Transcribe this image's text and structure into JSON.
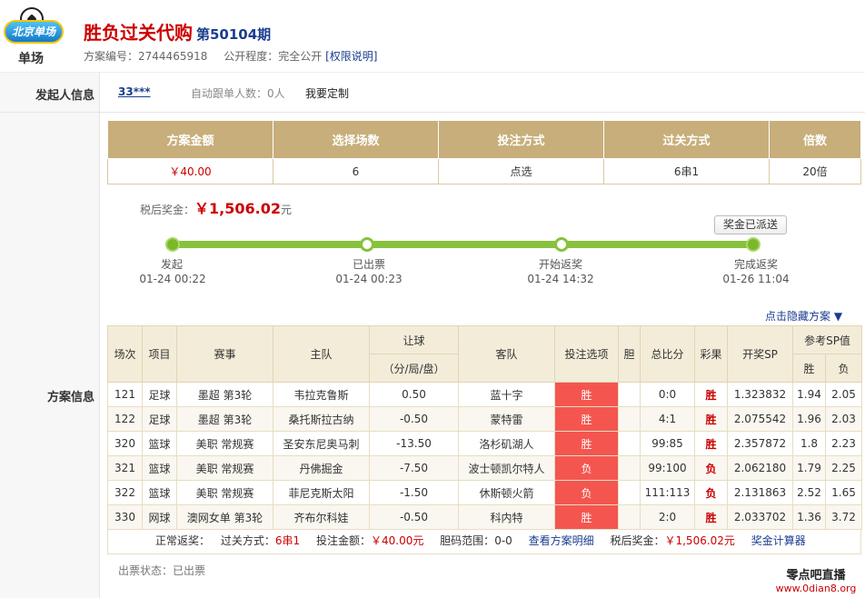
{
  "header": {
    "logo_text": "单场",
    "logo_badge": "北京单场",
    "title": "胜负过关代购",
    "period": "第50104期",
    "plan_no_label": "方案编号：",
    "plan_no": "2744465918",
    "public_label": "公开程度：",
    "public_value": "完全公开",
    "permission_link": "[权限说明]"
  },
  "initiator": {
    "label": "发起人信息",
    "user": "33***",
    "auto_follow": "自动跟单人数：0人",
    "custom": "我要定制"
  },
  "summary": {
    "headers": [
      "方案金额",
      "选择场数",
      "投注方式",
      "过关方式",
      "倍数"
    ],
    "values": [
      "￥40.00",
      "6",
      "点选",
      "6串1",
      "20倍"
    ]
  },
  "after_tax": {
    "label": "税后奖金：",
    "amount": "￥1,506.02",
    "unit": "元",
    "sent_button": "奖金已派送"
  },
  "progress": {
    "steps": [
      {
        "name": "发起",
        "time": "01-24 00:22"
      },
      {
        "name": "已出票",
        "time": "01-24 00:23"
      },
      {
        "name": "开始返奖",
        "time": "01-24 14:32"
      },
      {
        "name": "完成返奖",
        "time": "01-26 11:04"
      }
    ]
  },
  "plan": {
    "label": "方案信息",
    "toggle_link": "点击隐藏方案 ▼",
    "headers": {
      "no": "场次",
      "sport": "项目",
      "league": "赛事",
      "home": "主队",
      "handicap": "让球",
      "handicap_sub": "（分/局/盘）",
      "away": "客队",
      "pick": "投注选项",
      "banker": "胆",
      "score": "总比分",
      "result": "彩果",
      "sp": "开奖SP",
      "ref_sp": "参考SP值",
      "win": "胜",
      "lose": "负"
    },
    "rows": [
      {
        "no": "121",
        "sport": "足球",
        "league": "墨超 第3轮",
        "home": "韦拉克鲁斯",
        "handicap": "0.50",
        "away": "蓝十字",
        "pick": "胜",
        "banker": "",
        "score": "0:0",
        "result": "胜",
        "sp": "1.323832",
        "win": "1.94",
        "lose": "2.05"
      },
      {
        "no": "122",
        "sport": "足球",
        "league": "墨超 第3轮",
        "home": "桑托斯拉古纳",
        "handicap": "-0.50",
        "away": "蒙特雷",
        "pick": "胜",
        "banker": "",
        "score": "4:1",
        "result": "胜",
        "sp": "2.075542",
        "win": "1.96",
        "lose": "2.03"
      },
      {
        "no": "320",
        "sport": "篮球",
        "league": "美职 常规赛",
        "home": "圣安东尼奥马刺",
        "handicap": "-13.50",
        "away": "洛杉矶湖人",
        "pick": "胜",
        "banker": "",
        "score": "99:85",
        "result": "胜",
        "sp": "2.357872",
        "win": "1.8",
        "lose": "2.23"
      },
      {
        "no": "321",
        "sport": "篮球",
        "league": "美职 常规赛",
        "home": "丹佛掘金",
        "handicap": "-7.50",
        "away": "波士顿凯尔特人",
        "pick": "负",
        "banker": "",
        "score": "99:100",
        "result": "负",
        "sp": "2.062180",
        "win": "1.79",
        "lose": "2.25"
      },
      {
        "no": "322",
        "sport": "篮球",
        "league": "美职 常规赛",
        "home": "菲尼克斯太阳",
        "handicap": "-1.50",
        "away": "休斯顿火箭",
        "pick": "负",
        "banker": "",
        "score": "111:113",
        "result": "负",
        "sp": "2.131863",
        "win": "2.52",
        "lose": "1.65"
      },
      {
        "no": "330",
        "sport": "网球",
        "league": "澳网女单 第3轮",
        "home": "齐布尔科娃",
        "handicap": "-0.50",
        "away": "科内特",
        "pick": "胜",
        "banker": "",
        "score": "2:0",
        "result": "胜",
        "sp": "2.033702",
        "win": "1.36",
        "lose": "3.72"
      }
    ],
    "footer": {
      "normal_return": "正常返奖：",
      "pass_label": "过关方式：",
      "pass_value": "6串1",
      "amount_label": "投注金额：",
      "amount_value": "￥40.00元",
      "banker_label": "胆码范围：",
      "banker_value": "0-0",
      "detail_link": "查看方案明细",
      "tax_label": "税后奖金：",
      "tax_value": "￥1,506.02元",
      "calc_link": "奖金计算器"
    }
  },
  "ticket_status": "出票状态：已出票",
  "brand": {
    "name": "零点吧直播",
    "url": "www.0dian8.org"
  }
}
